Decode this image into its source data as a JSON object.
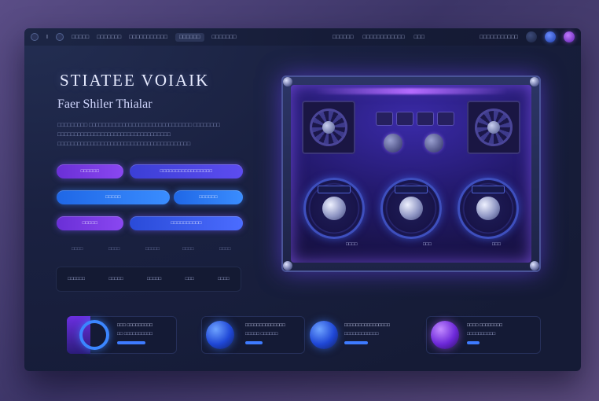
{
  "topbar": {
    "nav_left": [
      "I",
      "□□□□□",
      "□□□□□□□",
      "□□□□□□□□□□□",
      "□□□□□□",
      "□□□□□□□"
    ],
    "active_index": 4,
    "nav_center": [
      "□□□□□□",
      "□□□□□□□□□□□□",
      "□□□"
    ],
    "nav_right": [
      "□□□□□□□□□□□"
    ]
  },
  "hero": {
    "title": "STIATEE VOIAIK",
    "subtitle": "Faer Shiler Thialar",
    "description": "□□□□□□□□□ □□□□□□□□□□□□□□□□□□□□□□□□□□□□□□□ □□□□□□□□ □□□□□□□□□□□□□□□□□□□□□□□□□□□□□□□□□□ □□□□□□□□□□□□□□□□□□□□□□□□□□□□□□□□□□□□□□□□"
  },
  "buttons": {
    "row1": [
      "□□□□□□",
      "□□□□□□□□□□□□□□□□□"
    ],
    "row2": [
      "□□□□□",
      "□□□□□□"
    ],
    "row3": [
      "□□□□□",
      "□□□□□□□□□□"
    ]
  },
  "row_labels": [
    "□□□□",
    "□□□□",
    "□□□□□",
    "□□□□",
    "□□□□"
  ],
  "toolbar_items": [
    "□□□□□□",
    "□□□□□",
    "□□□□□",
    "□□□",
    "□□□□"
  ],
  "device": {
    "gauge_labels": [
      "□□□□",
      "□□□",
      "□□□"
    ]
  },
  "cards": [
    {
      "line1": "□□□ □□□□□□□□□",
      "line2": "□□ □□□□□□□□□□",
      "progress": 0.45
    },
    {
      "line1": "□□□□□□□□□□□□□□",
      "line2": "□□□□□ □□□□□□",
      "progress": 0.3
    },
    {
      "line1": "□□□□□□□□□□□□□□□□",
      "line2": "□□□□□□□□□□□□",
      "progress": 0.35
    },
    {
      "line1": "□□□□ □□□□□□□□",
      "line2": "□□□□□□□□□□",
      "progress": 0.2
    }
  ],
  "colors": {
    "accent_purple": "#7a3df0",
    "accent_blue": "#2f7bff",
    "panel_bg": "#1a2141"
  }
}
